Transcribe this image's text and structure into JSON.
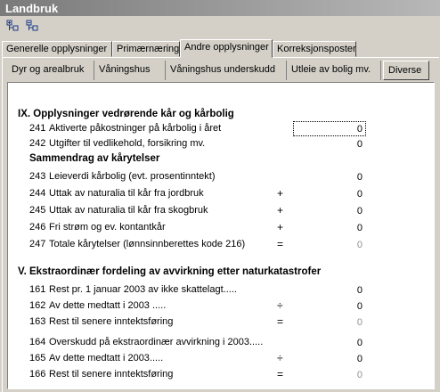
{
  "window": {
    "title": "Landbruk"
  },
  "toolbar": {
    "btn1_icon": "tree-expand-icon",
    "btn2_icon": "tree-collapse-icon"
  },
  "tabs_main": [
    "Generelle opplysninger",
    "Primærnæring",
    "Andre opplysninger",
    "Korreksjonsposter"
  ],
  "tabs_sub": [
    "Dyr og arealbruk",
    "Våningshus",
    "Våningshus underskudd",
    "Utleie av bolig mv.",
    "Diverse"
  ],
  "sections": {
    "ix_title": "IX. Opplysninger vedrørende kår og kårbolig",
    "summary_title": "Sammendrag av kårytelser",
    "v_title": "V. Ekstraordinær fordeling av avvirkning etter naturkatastrofer"
  },
  "rows": [
    {
      "num": "241",
      "label": "Aktiverte påkostninger på kårbolig i året",
      "op": "",
      "value": "0"
    },
    {
      "num": "242",
      "label": "Utgifter til vedlikehold, forsikring mv.",
      "op": "",
      "value": "0"
    },
    {
      "num": "243",
      "label": "Leieverdi kårbolig (evt. prosentinntekt)",
      "op": "",
      "value": "0"
    },
    {
      "num": "244",
      "label": "Uttak av naturalia til kår fra jordbruk",
      "op": "+",
      "value": "0"
    },
    {
      "num": "245",
      "label": "Uttak av naturalia til kår fra skogbruk",
      "op": "+",
      "value": "0"
    },
    {
      "num": "246",
      "label": "Fri strøm og ev. kontantkår",
      "op": "+",
      "value": "0"
    },
    {
      "num": "247",
      "label": "Totale kårytelser (lønnsinnberettes kode 216)",
      "op": "=",
      "value": "0"
    },
    {
      "num": "161",
      "label": "Rest pr. 1 januar 2003 av ikke skattelagt.....",
      "op": "",
      "value": "0"
    },
    {
      "num": "162",
      "label": "Av dette medtatt i 2003 .....",
      "op": "÷",
      "value": "0"
    },
    {
      "num": "163",
      "label": "Rest til senere inntektsføring",
      "op": "=",
      "value": "0"
    },
    {
      "num": "164",
      "label": "Overskudd på ekstraordinær avvirkning i 2003.....",
      "op": "",
      "value": "0"
    },
    {
      "num": "165",
      "label": "Av dette medtatt i 2003.....",
      "op": "÷",
      "value": "0"
    },
    {
      "num": "166",
      "label": "Rest til senere inntektsføring",
      "op": "=",
      "value": "0"
    }
  ]
}
